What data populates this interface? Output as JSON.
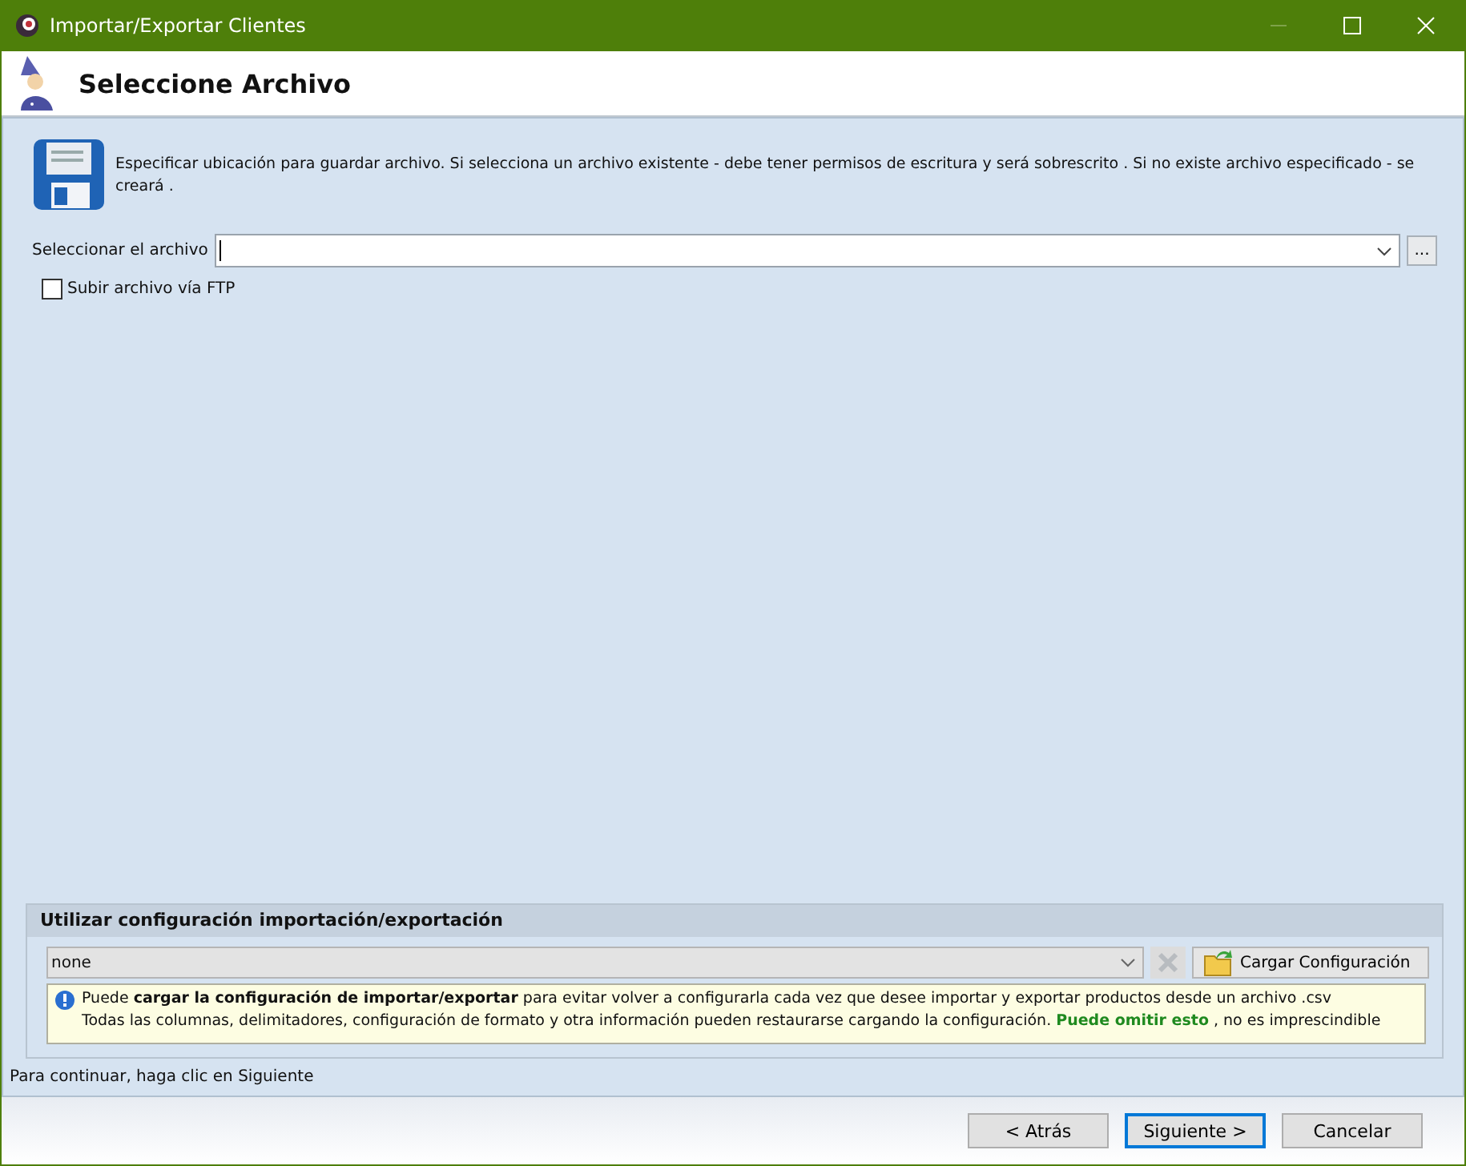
{
  "window": {
    "title": "Importar/Exportar Clientes"
  },
  "header": {
    "title": "Seleccione Archivo"
  },
  "description": "Especificar ubicación para guardar archivo. Si selecciona un archivo existente - debe tener permisos de escritura y será sobrescrito . Si no existe archivo especificado - se creará .",
  "file_field": {
    "label": "Seleccionar el archivo",
    "browse": "..."
  },
  "ftp": {
    "label": "Subir archivo vía FTP",
    "checked": false
  },
  "config": {
    "title": "Utilizar configuración importación/exportación",
    "value": "none",
    "load_button": "Cargar Configuración",
    "info_lines": [
      "Puede **cargar la configuración de importar/exportar** para evitar volver a configurarla cada vez que desee importar y exportar productos desde un archivo .csv",
      "Todas las columnas, delimitadores, configuración de formato y otra información pueden restaurarse cargando la configuración. **Puede omitir esto** , no es imprescindible"
    ]
  },
  "status": "Para continuar, haga clic en Siguiente",
  "buttons": [
    {
      "label": "< Atrás",
      "selected": false
    },
    {
      "label": "Siguiente >",
      "selected": true
    },
    {
      "label": "Cancelar",
      "selected": false
    }
  ]
}
